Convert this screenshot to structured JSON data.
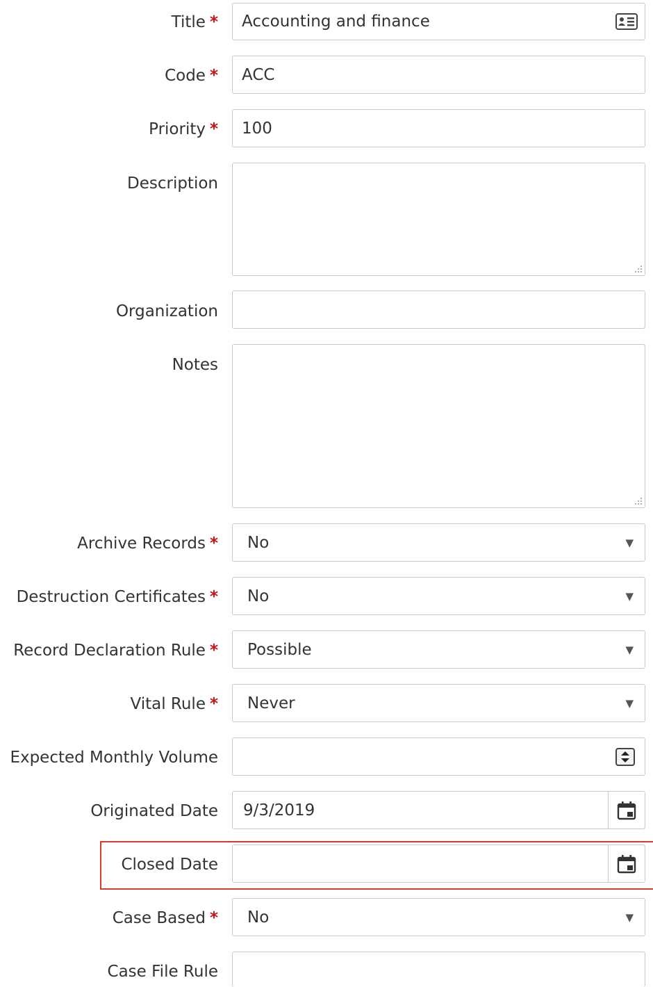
{
  "form": {
    "title": {
      "label": "Title",
      "required": "*",
      "value": "Accounting and finance",
      "icon": "contact-card-icon"
    },
    "code": {
      "label": "Code",
      "required": "*",
      "value": "ACC"
    },
    "priority": {
      "label": "Priority",
      "required": "*",
      "value": "100"
    },
    "description": {
      "label": "Description",
      "value": ""
    },
    "organization": {
      "label": "Organization",
      "value": ""
    },
    "notes": {
      "label": "Notes",
      "value": ""
    },
    "archive_records": {
      "label": "Archive Records",
      "required": "*",
      "value": "No"
    },
    "destruction_certificates": {
      "label": "Destruction Certificates",
      "required": "*",
      "value": "No"
    },
    "record_declaration_rule": {
      "label": "Record Declaration Rule",
      "required": "*",
      "value": "Possible"
    },
    "vital_rule": {
      "label": "Vital Rule",
      "required": "*",
      "value": "Never"
    },
    "expected_monthly_volume": {
      "label": "Expected Monthly Volume",
      "value": "",
      "icon": "spinner-icon"
    },
    "originated_date": {
      "label": "Originated Date",
      "value": "9/3/2019",
      "icon": "calendar-icon"
    },
    "closed_date": {
      "label": "Closed Date",
      "value": "",
      "icon": "calendar-icon",
      "highlighted": true
    },
    "case_based": {
      "label": "Case Based",
      "required": "*",
      "value": "No"
    },
    "case_file_rule": {
      "label": "Case File Rule",
      "value": ""
    }
  },
  "colors": {
    "required_marker": "#cc1111",
    "highlight_border": "#d93a2b",
    "field_border": "#c8c8c8",
    "text": "#333333"
  }
}
